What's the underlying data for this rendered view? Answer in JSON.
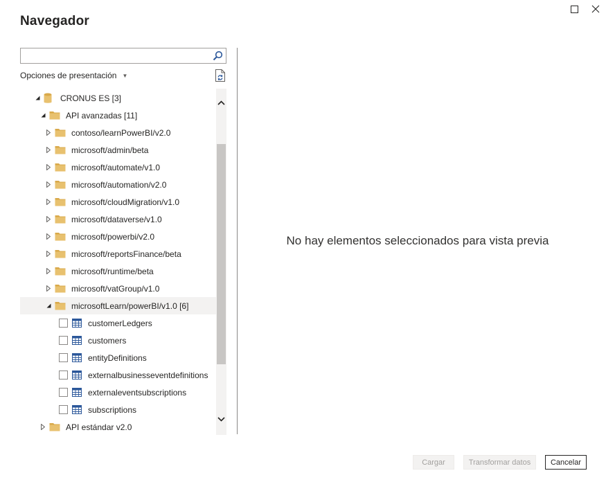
{
  "window": {
    "title": "Navegador",
    "controls": [
      "maximize-icon",
      "close-icon"
    ]
  },
  "search": {
    "value": "",
    "placeholder": "",
    "icon": "search-icon"
  },
  "display_options": {
    "label": "Opciones de presentación",
    "icon": "chevron-down-icon",
    "refresh_icon": "refresh-document-icon"
  },
  "tree": {
    "rows": [
      {
        "label": "CRONUS ES [3]",
        "level": 0,
        "kind": "database",
        "expander": "expanded",
        "checkbox": false
      },
      {
        "label": "API avanzadas [11]",
        "level": 1,
        "kind": "folder",
        "expander": "expanded",
        "checkbox": false
      },
      {
        "label": "contoso/learnPowerBI/v2.0",
        "level": 2,
        "kind": "folder",
        "expander": "collapsed",
        "checkbox": false
      },
      {
        "label": "microsoft/admin/beta",
        "level": 2,
        "kind": "folder",
        "expander": "collapsed",
        "checkbox": false
      },
      {
        "label": "microsoft/automate/v1.0",
        "level": 2,
        "kind": "folder",
        "expander": "collapsed",
        "checkbox": false
      },
      {
        "label": "microsoft/automation/v2.0",
        "level": 2,
        "kind": "folder",
        "expander": "collapsed",
        "checkbox": false
      },
      {
        "label": "microsoft/cloudMigration/v1.0",
        "level": 2,
        "kind": "folder",
        "expander": "collapsed",
        "checkbox": false
      },
      {
        "label": "microsoft/dataverse/v1.0",
        "level": 2,
        "kind": "folder",
        "expander": "collapsed",
        "checkbox": false
      },
      {
        "label": "microsoft/powerbi/v2.0",
        "level": 2,
        "kind": "folder",
        "expander": "collapsed",
        "checkbox": false
      },
      {
        "label": "microsoft/reportsFinance/beta",
        "level": 2,
        "kind": "folder",
        "expander": "collapsed",
        "checkbox": false
      },
      {
        "label": "microsoft/runtime/beta",
        "level": 2,
        "kind": "folder",
        "expander": "collapsed",
        "checkbox": false
      },
      {
        "label": "microsoft/vatGroup/v1.0",
        "level": 2,
        "kind": "folder",
        "expander": "collapsed",
        "checkbox": false
      },
      {
        "label": "microsoftLearn/powerBI/v1.0 [6]",
        "level": 2,
        "kind": "folder",
        "expander": "expanded",
        "checkbox": false,
        "selected": true
      },
      {
        "label": "customerLedgers",
        "level": 3,
        "kind": "table",
        "expander": "none",
        "checkbox": true
      },
      {
        "label": "customers",
        "level": 3,
        "kind": "table",
        "expander": "none",
        "checkbox": true
      },
      {
        "label": "entityDefinitions",
        "level": 3,
        "kind": "table",
        "expander": "none",
        "checkbox": true
      },
      {
        "label": "externalbusinesseventdefinitions",
        "level": 3,
        "kind": "table",
        "expander": "none",
        "checkbox": true
      },
      {
        "label": "externaleventsubscriptions",
        "level": 3,
        "kind": "table",
        "expander": "none",
        "checkbox": true
      },
      {
        "label": "subscriptions",
        "level": 3,
        "kind": "table",
        "expander": "none",
        "checkbox": true
      },
      {
        "label": "API estándar v2.0",
        "level": 1,
        "kind": "folder",
        "expander": "collapsed",
        "checkbox": false
      }
    ]
  },
  "preview": {
    "message": "No hay elementos seleccionados para vista previa"
  },
  "footer": {
    "load_label": "Cargar",
    "transform_label": "Transformar datos",
    "cancel_label": "Cancelar"
  },
  "colors": {
    "folder": "#e8c16f",
    "folder_dark": "#d9a94a",
    "table_icon": "#2b579a",
    "selected_row": "#f3f2f1",
    "scroll_thumb": "#c8c6c4",
    "disabled_text": "#a19f9d"
  }
}
